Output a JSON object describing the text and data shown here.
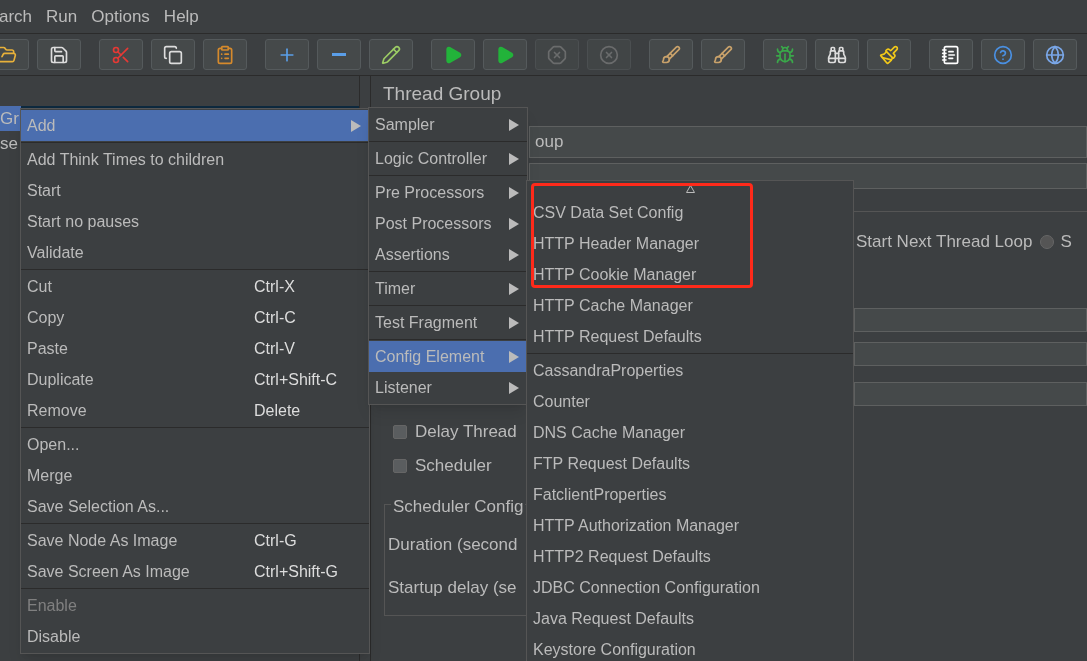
{
  "menu_bar": [
    {
      "label": "arch"
    },
    {
      "label": "Run"
    },
    {
      "label": "Options"
    },
    {
      "label": "Help"
    }
  ],
  "toolbar": [
    [
      {
        "kind": "open",
        "disabled": false
      },
      {
        "kind": "save",
        "disabled": false
      }
    ],
    [
      {
        "kind": "cut",
        "disabled": false
      },
      {
        "kind": "copy",
        "disabled": false
      },
      {
        "kind": "paste",
        "disabled": false
      }
    ],
    [
      {
        "kind": "expand",
        "disabled": false
      },
      {
        "kind": "collapse",
        "disabled": false
      },
      {
        "kind": "toggle",
        "disabled": false
      }
    ],
    [
      {
        "kind": "start",
        "disabled": false
      },
      {
        "kind": "start_no_pauses",
        "disabled": false
      },
      {
        "kind": "stop",
        "disabled": true
      },
      {
        "kind": "shutdown",
        "disabled": true
      }
    ],
    [
      {
        "kind": "clear",
        "disabled": false
      },
      {
        "kind": "clear_all",
        "disabled": false
      }
    ],
    [
      {
        "kind": "function",
        "disabled": false
      },
      {
        "kind": "search",
        "disabled": false
      },
      {
        "kind": "reset",
        "disabled": false
      }
    ],
    [
      {
        "kind": "log",
        "disabled": false
      },
      {
        "kind": "help",
        "disabled": false
      },
      {
        "kind": "remote",
        "disabled": false
      }
    ]
  ],
  "tree": [
    {
      "label": "Gr",
      "selected": true
    },
    {
      "label": "se",
      "selected": false
    }
  ],
  "panel": {
    "title": "Thread Group",
    "name_value": "oup",
    "radio": [
      {
        "label": "Start Next Thread Loop",
        "selected": false
      },
      {
        "label": "S",
        "selected": false
      }
    ],
    "checkboxes": [
      {
        "label": "Delay Thread",
        "checked": false
      },
      {
        "label": "Scheduler",
        "checked": false
      }
    ],
    "scheduler_group": {
      "title": "Scheduler Config",
      "labels": [
        "Duration (second",
        "Startup delay (se"
      ]
    }
  },
  "main_menu": {
    "groups": [
      {
        "items": [
          {
            "label": "Add",
            "submenu": true,
            "selected": true,
            "disabled": false
          }
        ]
      },
      {
        "items": [
          {
            "label": "Add Think Times to children",
            "submenu": false,
            "selected": false,
            "disabled": false
          },
          {
            "label": "Start",
            "submenu": false,
            "selected": false,
            "disabled": false
          },
          {
            "label": "Start no pauses",
            "submenu": false,
            "selected": false,
            "disabled": false
          },
          {
            "label": "Validate",
            "submenu": false,
            "selected": false,
            "disabled": false
          }
        ]
      },
      {
        "items": [
          {
            "label": "Cut",
            "shortcut": "Ctrl-X",
            "submenu": false,
            "selected": false,
            "disabled": false
          },
          {
            "label": "Copy",
            "shortcut": "Ctrl-C",
            "submenu": false,
            "selected": false,
            "disabled": false
          },
          {
            "label": "Paste",
            "shortcut": "Ctrl-V",
            "submenu": false,
            "selected": false,
            "disabled": false
          },
          {
            "label": "Duplicate",
            "shortcut": "Ctrl+Shift-C",
            "submenu": false,
            "selected": false,
            "disabled": false
          },
          {
            "label": "Remove",
            "shortcut": "Delete",
            "submenu": false,
            "selected": false,
            "disabled": false
          }
        ]
      },
      {
        "items": [
          {
            "label": "Open...",
            "submenu": false,
            "selected": false,
            "disabled": false
          },
          {
            "label": "Merge",
            "submenu": false,
            "selected": false,
            "disabled": false
          },
          {
            "label": "Save Selection As...",
            "submenu": false,
            "selected": false,
            "disabled": false
          }
        ]
      },
      {
        "items": [
          {
            "label": "Save Node As Image",
            "shortcut": "Ctrl-G",
            "submenu": false,
            "selected": false,
            "disabled": false
          },
          {
            "label": "Save Screen As Image",
            "shortcut": "Ctrl+Shift-G",
            "submenu": false,
            "selected": false,
            "disabled": false
          }
        ]
      },
      {
        "items": [
          {
            "label": "Enable",
            "submenu": false,
            "selected": false,
            "disabled": true
          },
          {
            "label": "Disable",
            "submenu": false,
            "selected": false,
            "disabled": false
          }
        ]
      }
    ]
  },
  "add_menu": {
    "groups": [
      {
        "items": [
          {
            "label": "Sampler",
            "submenu": true,
            "selected": false,
            "disabled": false
          }
        ]
      },
      {
        "items": [
          {
            "label": "Logic Controller",
            "submenu": true,
            "selected": false,
            "disabled": false
          }
        ]
      },
      {
        "items": [
          {
            "label": "Pre Processors",
            "submenu": true,
            "selected": false,
            "disabled": false
          },
          {
            "label": "Post Processors",
            "submenu": true,
            "selected": false,
            "disabled": false
          },
          {
            "label": "Assertions",
            "submenu": true,
            "selected": false,
            "disabled": false
          }
        ]
      },
      {
        "items": [
          {
            "label": "Timer",
            "submenu": true,
            "selected": false,
            "disabled": false
          }
        ]
      },
      {
        "items": [
          {
            "label": "Test Fragment",
            "submenu": true,
            "selected": false,
            "disabled": false
          }
        ]
      },
      {
        "items": [
          {
            "label": "Config Element",
            "submenu": true,
            "selected": true,
            "disabled": false
          },
          {
            "label": "Listener",
            "submenu": true,
            "selected": false,
            "disabled": false
          }
        ]
      }
    ]
  },
  "config_menu": {
    "scroll_up": true,
    "groups": [
      {
        "items": [
          {
            "label": "CSV Data Set Config",
            "selected": false,
            "annotated": true
          },
          {
            "label": "HTTP Header Manager",
            "selected": false,
            "annotated": true
          },
          {
            "label": "HTTP Cookie Manager",
            "selected": false,
            "annotated": true
          },
          {
            "label": "HTTP Cache Manager",
            "selected": false,
            "annotated": false
          },
          {
            "label": "HTTP Request Defaults",
            "selected": false,
            "annotated": false
          }
        ]
      },
      {
        "items": [
          {
            "label": "CassandraProperties",
            "selected": false,
            "annotated": false
          },
          {
            "label": "Counter",
            "selected": false,
            "annotated": false
          },
          {
            "label": "DNS Cache Manager",
            "selected": false,
            "annotated": false
          },
          {
            "label": "FTP Request Defaults",
            "selected": false,
            "annotated": false
          },
          {
            "label": "FatclientProperties",
            "selected": false,
            "annotated": false
          },
          {
            "label": "HTTP Authorization Manager",
            "selected": false,
            "annotated": false
          },
          {
            "label": "HTTP2 Request Defaults",
            "selected": false,
            "annotated": false
          },
          {
            "label": "JDBC Connection Configuration",
            "selected": false,
            "annotated": false
          },
          {
            "label": "Java Request Defaults",
            "selected": false,
            "annotated": false
          },
          {
            "label": "Keystore Configuration",
            "selected": false,
            "annotated": false
          }
        ]
      }
    ]
  }
}
